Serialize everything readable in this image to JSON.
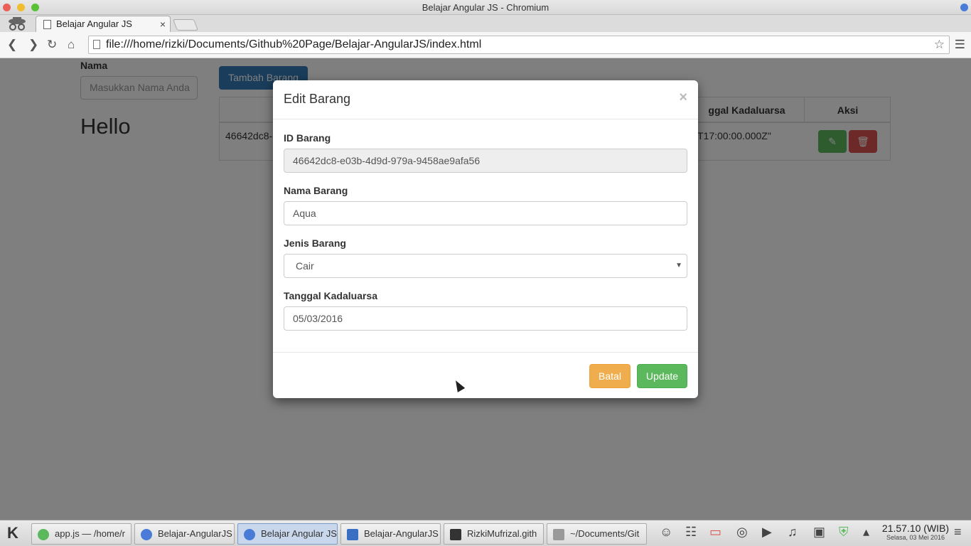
{
  "window": {
    "title": "Belajar Angular JS - Chromium"
  },
  "browser": {
    "tab_label": "Belajar Angular JS",
    "url": "file:///home/rizki/Documents/Github%20Page/Belajar-AngularJS/index.html"
  },
  "page": {
    "name_label": "Nama",
    "name_placeholder": "Masukkan Nama Anda",
    "greeting": "Hello",
    "add_button": "Tambah Barang",
    "table": {
      "headers": [
        "ggal Kadaluarsa",
        "Aksi"
      ],
      "row": {
        "id_partial": "46642dc8-",
        "date_partial": "T17:00:00.000Z\""
      }
    }
  },
  "modal": {
    "title": "Edit Barang",
    "fields": {
      "id_label": "ID Barang",
      "id_value": "46642dc8-e03b-4d9d-979a-9458ae9afa56",
      "name_label": "Nama Barang",
      "name_value": "Aqua",
      "type_label": "Jenis Barang",
      "type_value": "Cair",
      "expiry_label": "Tanggal Kadaluarsa",
      "expiry_value": "05/03/2016"
    },
    "cancel_button": "Batal",
    "update_button": "Update"
  },
  "taskbar": {
    "tasks": [
      {
        "label": "app.js — /home/r",
        "color": "#5cb85c"
      },
      {
        "label": "Belajar-AngularJS",
        "color": "#4a7bd6"
      },
      {
        "label": "Belajar Angular JS",
        "color": "#4a7bd6"
      },
      {
        "label": "Belajar-AngularJS",
        "color": "#3b6fc4"
      },
      {
        "label": "RizkiMufrizal.gith",
        "color": "#333333"
      },
      {
        "label": "~/Documents/Git",
        "color": "#999999"
      }
    ],
    "clock_time": "21.57.10 (WIB)",
    "clock_date": "Selasa, 03 Mei 2016"
  }
}
